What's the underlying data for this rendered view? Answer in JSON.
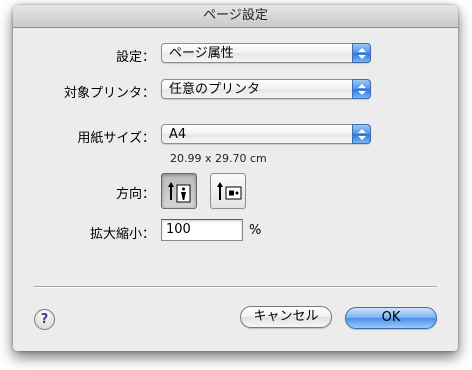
{
  "window": {
    "title": "ページ設定"
  },
  "settings": {
    "label": "設定：",
    "value": "ページ属性"
  },
  "printer": {
    "label": "対象プリンタ：",
    "value": "任意のプリンタ"
  },
  "paper": {
    "label": "用紙サイズ：",
    "value": "A4",
    "dimensions": "20.99 x 29.70 cm"
  },
  "orientation": {
    "label": "方向：",
    "selected": "portrait",
    "options": [
      "portrait",
      "landscape"
    ]
  },
  "scale": {
    "label": "拡大縮小：",
    "value": "100",
    "unit": "%"
  },
  "buttons": {
    "help": "?",
    "cancel": "キャンセル",
    "ok": "OK"
  },
  "colors": {
    "accent": "#4a90e8",
    "help_glyph": "#5a2d9a"
  }
}
